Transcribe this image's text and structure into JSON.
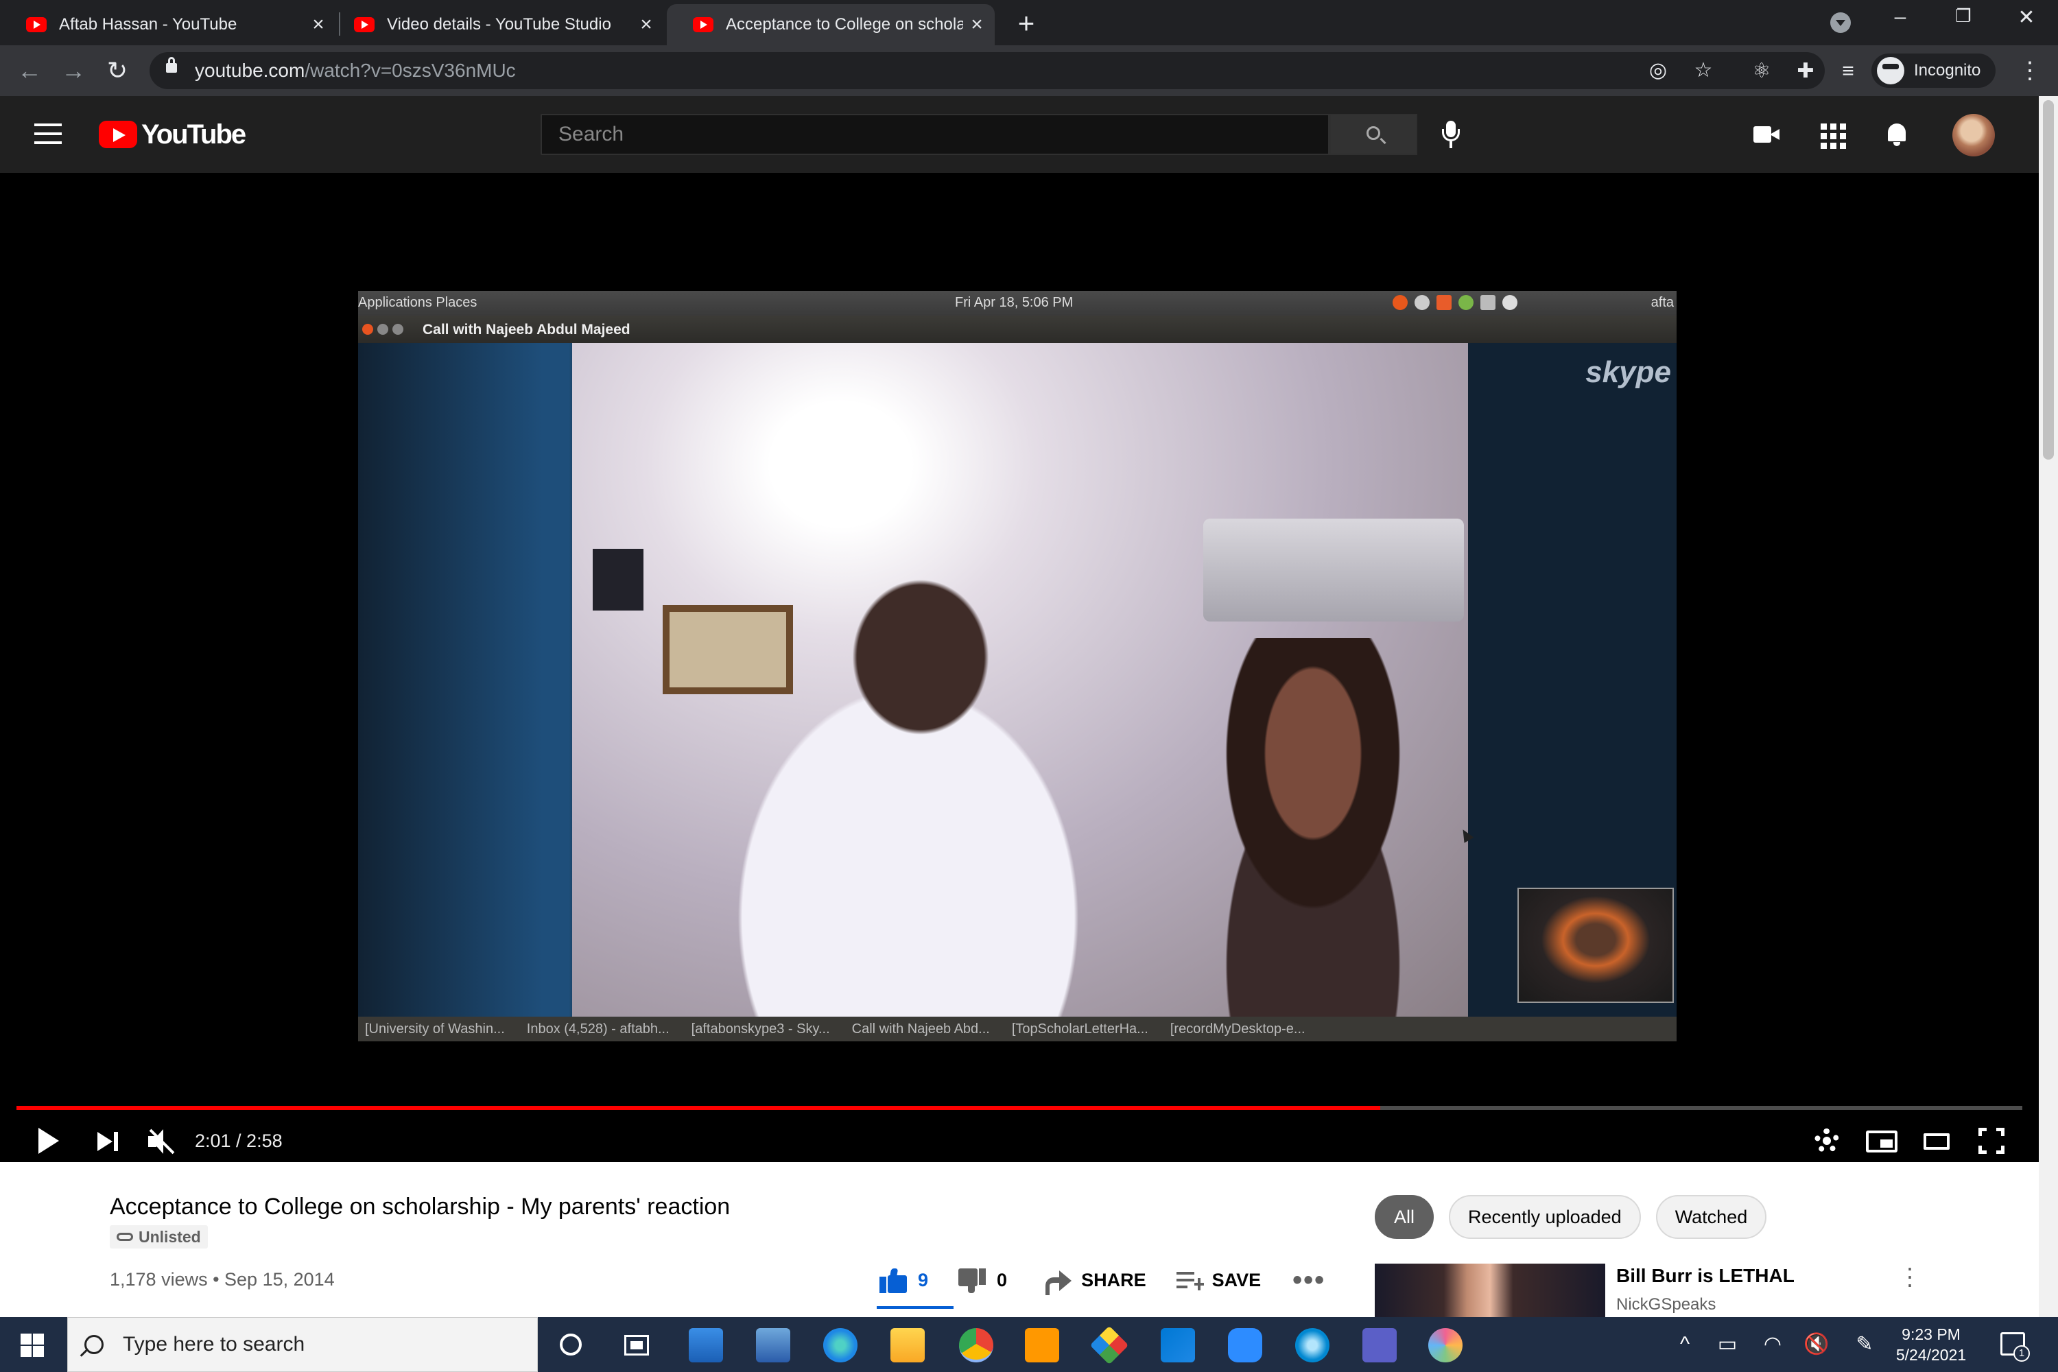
{
  "browser": {
    "tabs": [
      {
        "title": "Aftab Hassan - YouTube",
        "active": false
      },
      {
        "title": "Video details - YouTube Studio",
        "active": false
      },
      {
        "title": "Acceptance to College on schola",
        "active": true
      }
    ],
    "url_host": "youtube.com",
    "url_path": "/watch?v=0szsV36nMUc",
    "profile_label": "Incognito"
  },
  "youtube": {
    "logo_text": "YouTube",
    "search_placeholder": "Search"
  },
  "player": {
    "current_time": "2:01",
    "duration": "2:58",
    "time_display": "2:01 / 2:58",
    "progress": 0.68,
    "muted": true,
    "video_content": {
      "desktop_menu": "Applications  Places",
      "desktop_clock": "Fri Apr 18,  5:06 PM",
      "desktop_user": "afta",
      "call_window_title": "Call with Najeeb Abdul Majeed",
      "watermark": "skype",
      "taskbar_items": [
        "[University of Washin...",
        "Inbox (4,528) - aftabh...",
        "[aftabonskype3 - Sky...",
        "Call with Najeeb Abd...",
        "[TopScholarLetterHa...",
        "[recordMyDesktop-e..."
      ]
    }
  },
  "video": {
    "title": "Acceptance to College on scholarship - My parents' reaction",
    "visibility": "Unlisted",
    "meta": "1,178 views • Sep 15, 2014",
    "likes": "9",
    "dislikes": "0",
    "share_label": "SHARE",
    "save_label": "SAVE"
  },
  "sidebar": {
    "chips": [
      {
        "label": "All",
        "selected": true
      },
      {
        "label": "Recently uploaded",
        "selected": false
      },
      {
        "label": "Watched",
        "selected": false
      }
    ],
    "recommendation": {
      "title": "Bill Burr is LETHAL",
      "channel": "NickGSpeaks"
    }
  },
  "taskbar": {
    "search_placeholder": "Type here to search",
    "time": "9:23 PM",
    "date": "5/24/2021",
    "notification_count": "1"
  },
  "colors": {
    "youtube_red": "#ff0000",
    "like_blue": "#065fd4",
    "chrome_dark": "#202124",
    "taskbar": "#1f2d44"
  }
}
